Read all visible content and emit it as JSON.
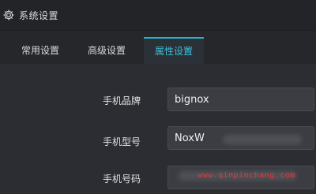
{
  "window": {
    "title": "系统设置",
    "icon": "gear-icon"
  },
  "tabs": [
    {
      "label": "常用设置",
      "active": false
    },
    {
      "label": "高级设置",
      "active": false
    },
    {
      "label": "属性设置",
      "active": true
    }
  ],
  "form": {
    "brand": {
      "label": "手机品牌",
      "value": "bignox"
    },
    "model": {
      "label": "手机型号",
      "value": "NoxW"
    },
    "phone": {
      "label": "手机号码",
      "value": ""
    }
  },
  "watermark": "www.qinpinchang.com",
  "colors": {
    "accent": "#38c2db",
    "background": "#2b2d32",
    "titlebar": "#232428",
    "watermark": "#e3383a"
  }
}
